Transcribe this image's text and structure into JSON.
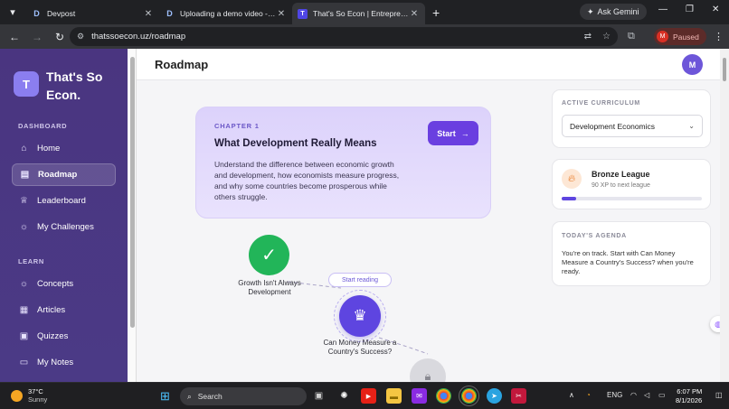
{
  "browser": {
    "tabs": [
      {
        "title": "Devpost",
        "favicon": "D",
        "active": false
      },
      {
        "title": "Uploading a demo video - Devpost",
        "favicon": "D",
        "active": false
      },
      {
        "title": "That's So Econ | Entrepreneurial",
        "favicon": "T",
        "active": true
      }
    ],
    "gemini_label": "Ask Gemini",
    "url": "thatssoecon.uz/roadmap",
    "profile_initial": "M",
    "profile_status": "Paused"
  },
  "sidebar": {
    "brand_initial": "T",
    "brand_name": "That's So Econ.",
    "dashboard_heading": "DASHBOARD",
    "dashboard_items": [
      {
        "label": "Home",
        "icon": "home-icon"
      },
      {
        "label": "Roadmap",
        "icon": "map-icon",
        "active": true
      },
      {
        "label": "Leaderboard",
        "icon": "trophy-icon"
      },
      {
        "label": "My Challenges",
        "icon": "lightbulb-icon"
      }
    ],
    "learn_heading": "LEARN",
    "learn_items": [
      {
        "label": "Concepts",
        "icon": "lightbulb-icon"
      },
      {
        "label": "Articles",
        "icon": "document-icon"
      },
      {
        "label": "Quizzes",
        "icon": "quiz-icon"
      },
      {
        "label": "My Notes",
        "icon": "notebook-icon"
      }
    ]
  },
  "header": {
    "title": "Roadmap",
    "avatar_initial": "M"
  },
  "chapter": {
    "label": "CHAPTER 1",
    "title": "What Development Really Means",
    "description": "Understand the difference between economic growth and development, how economists measure progress, and why some countries become prosperous while others struggle.",
    "start_label": "Start"
  },
  "roadmap": {
    "nodes": [
      {
        "label": "Growth Isn't Always Development",
        "state": "completed"
      },
      {
        "label": "Can Money Measure a Country's Success?",
        "state": "current",
        "badge": "Start reading"
      },
      {
        "label": "",
        "state": "locked"
      }
    ]
  },
  "right_panel": {
    "curriculum_heading": "ACTIVE CURRICULUM",
    "curriculum_value": "Development Economics",
    "league_name": "Bronze League",
    "league_sub": "90 XP to next league",
    "league_progress": 0.1,
    "agenda_heading": "TODAY'S AGENDA",
    "agenda_text": "You're on track. Start with Can Money Measure a Country's Success? when you're ready."
  },
  "taskbar": {
    "temperature": "37°C",
    "weather": "Sunny",
    "search_label": "Search",
    "language": "ENG",
    "time": "6:07 PM",
    "date": "8/1/2026"
  },
  "colors": {
    "accent": "#5e45e0",
    "sidebar": "#4a3580",
    "success": "#22b559"
  }
}
